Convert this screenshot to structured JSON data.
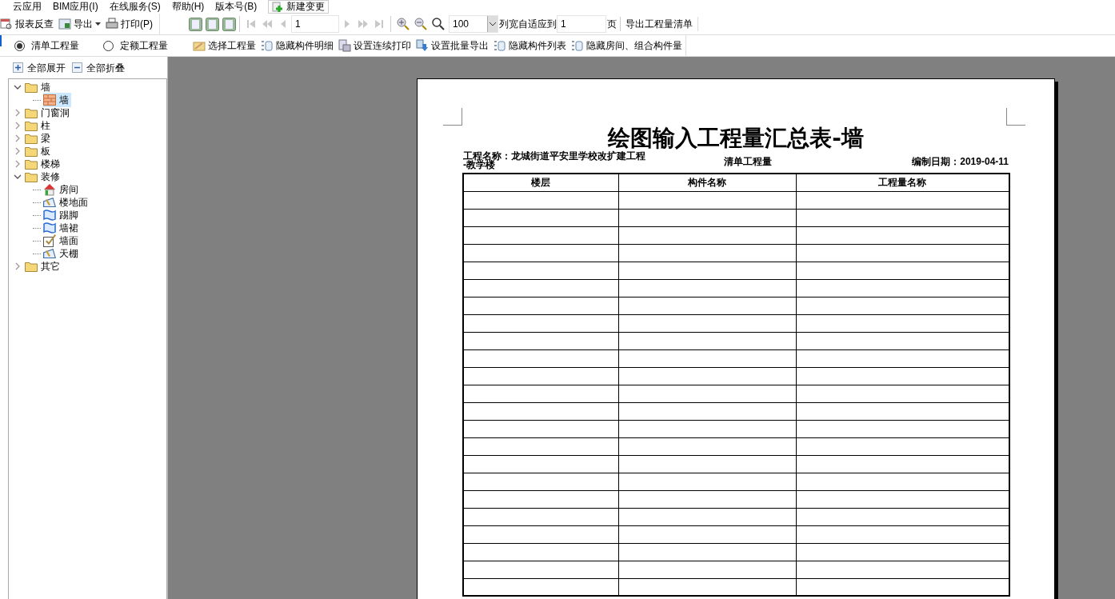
{
  "menu": [
    "云应用",
    "BIM应用(I)",
    "在线服务(S)",
    "帮助(H)",
    "版本号(B)",
    "新建变更"
  ],
  "toolbar": {
    "left": [
      {
        "label": "报表反查",
        "dropdown": false
      },
      {
        "label": "导出",
        "dropdown": true
      },
      {
        "label": "打印(P)",
        "dropdown": false
      }
    ],
    "page_input": "1",
    "zoom": "100",
    "fit_label": "列宽自适应到",
    "fit_value": "1",
    "fit_unit": "页",
    "export_list": "导出工程量清单"
  },
  "options": [
    {
      "label": "清单工程量",
      "selected": true
    },
    {
      "label": "定额工程量",
      "selected": false
    }
  ],
  "actions": [
    "选择工程量",
    "隐藏构件明细",
    "设置连续打印",
    "设置批量导出",
    "隐藏构件列表",
    "隐藏房间、组合构件量"
  ],
  "tree_buttons": [
    "全部展开",
    "全部折叠"
  ],
  "tree": [
    {
      "label": "墙",
      "expanded": true,
      "children": [
        {
          "label": "墙",
          "selected": true
        }
      ]
    },
    {
      "label": "门窗洞",
      "expanded": false
    },
    {
      "label": "柱",
      "expanded": false
    },
    {
      "label": "梁",
      "expanded": false
    },
    {
      "label": "板",
      "expanded": false
    },
    {
      "label": "楼梯",
      "expanded": false
    },
    {
      "label": "装修",
      "expanded": true,
      "children": [
        {
          "label": "房间",
          "selected": false
        },
        {
          "label": "楼地面",
          "selected": false
        },
        {
          "label": "踢脚",
          "selected": false
        },
        {
          "label": "墙裙",
          "selected": false
        },
        {
          "label": "墙面",
          "selected": false
        },
        {
          "label": "天棚",
          "selected": false
        }
      ]
    },
    {
      "label": "其它",
      "expanded": false
    }
  ],
  "report": {
    "title": "绘图输入工程量汇总表-墙",
    "project": "工程名称：龙城街道平安里学校改扩建工程",
    "project_line2": "-教学楼",
    "type": "清单工程量",
    "date": "编制日期：2019-04-11",
    "columns": [
      "楼层",
      "构件名称",
      "工程量名称"
    ]
  }
}
